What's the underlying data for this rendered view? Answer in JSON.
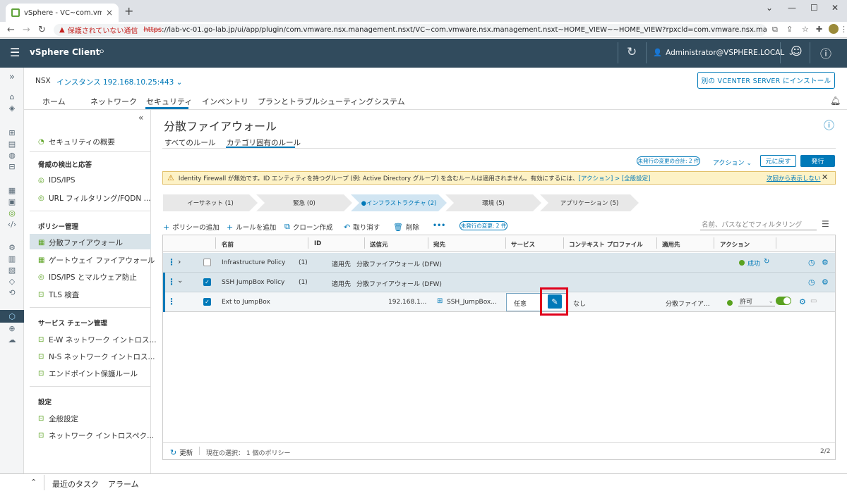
{
  "browser": {
    "tab_title": "vSphere - VC~com.vmware.nsx.n",
    "tab_close": "×",
    "new_tab": "+",
    "window_minimize": "—",
    "window_restore": "☐",
    "window_close": "✕",
    "window_menu": "⌄",
    "insecure_label": "保護されていない通信",
    "url_https": "https",
    "url_rest": "://lab-vc-01.go-lab.jp/ui/app/plugin/com.vmware.nsx.management.nsxt/VC~com.vmware.nsx.management.nsxt~HOME_VIEW~~HOME_VIEW?rpxcld=com.vmware.nsx.management.nsxt:3.2.0.1:-5535..."
  },
  "vsphere": {
    "title": "vSphere Client",
    "user": "Administrator@VSPHERE.LOCAL",
    "user_caret": "⌄"
  },
  "nsx": {
    "label": "NSX",
    "instance": "インスタンス 192.168.10.25:443",
    "instance_caret": "⌄",
    "other_vc_button": "別の VCENTER SERVER にインストール"
  },
  "topnav": [
    "ホーム",
    "ネットワーク",
    "セキュリティ",
    "インベントリ",
    "プランとトラブルシューティング",
    "システム"
  ],
  "sidenav": {
    "collapse": "«",
    "overview": "セキュリティの概要",
    "threat_header": "脅威の検出と応答",
    "threat_items": [
      "IDS/IPS",
      "URL フィルタリング/FQDN ..."
    ],
    "policy_header": "ポリシー管理",
    "policy_items": [
      "分散ファイアウォール",
      "ゲートウェイ ファイアウォール",
      "IDS/IPS とマルウェア防止",
      "TLS 検査"
    ],
    "service_header": "サービス チェーン管理",
    "service_items": [
      "E-W ネットワーク イントロス...",
      "N-S ネットワーク イントロス...",
      "エンドポイント保護ルール"
    ],
    "settings_header": "設定",
    "settings_items": [
      "全般設定",
      "ネットワーク イントロスペク..."
    ]
  },
  "page": {
    "title": "分散ファイアウォール",
    "subtabs": [
      "すべてのルール",
      "カテゴリ固有のルール"
    ],
    "unpublished_total": "未発行の変更の合計: 2 件",
    "action": "アクション",
    "action_caret": "⌄",
    "revert": "元に戻す",
    "publish": "発行",
    "alert_text": "Identity Firewall が無効です。ID エンティティを持つグループ (例: Active Directory グループ) を含むルールは適用されません。有効にするには、",
    "alert_link": "[アクション] > [全般設定]",
    "hide_again": "次回から表示しない",
    "alert_close": "✕",
    "categories": [
      "イーサネット (1)",
      "緊急 (0)",
      "●インフラストラクチャ (2)",
      "環境 (5)",
      "アプリケーション (5)"
    ],
    "toolbar": {
      "add_policy": "ポリシーの追加",
      "add_rule": "ルールを追加",
      "clone": "クローン作成",
      "undo": "取り消す",
      "delete": "削除",
      "more": "•••",
      "unpublished": "未発行の変更: 2 件",
      "filter_placeholder": "名前、パスなどでフィルタリング"
    }
  },
  "grid": {
    "headers": [
      "名前",
      "ID",
      "送信元",
      "宛先",
      "サービス",
      "コンテキスト プロファイル",
      "適用先",
      "アクション"
    ],
    "policy1": {
      "name": "Infrastructure Policy",
      "id": "(1)",
      "applied_label": "適用先",
      "applied": "分散ファイアウォール (DFW)",
      "status": "成功"
    },
    "policy2": {
      "name": "SSH JumpBox Policy",
      "id": "(1)",
      "applied_label": "適用先",
      "applied": "分散ファイアウォール (DFW)"
    },
    "rule": {
      "name": "Ext to JumpBox",
      "source": "192.168.1...",
      "dest": "SSH_JumpBox...",
      "service": "任意",
      "profile": "なし",
      "applied": "分散ファイア...",
      "action": "許可",
      "action_caret": "⌄"
    },
    "refresh": "更新",
    "selection": "現在の選択： 1 個のポリシー",
    "page": "2/2"
  },
  "bottom": {
    "expand": "⌃",
    "tasks": "最近のタスク",
    "alarms": "アラーム"
  }
}
